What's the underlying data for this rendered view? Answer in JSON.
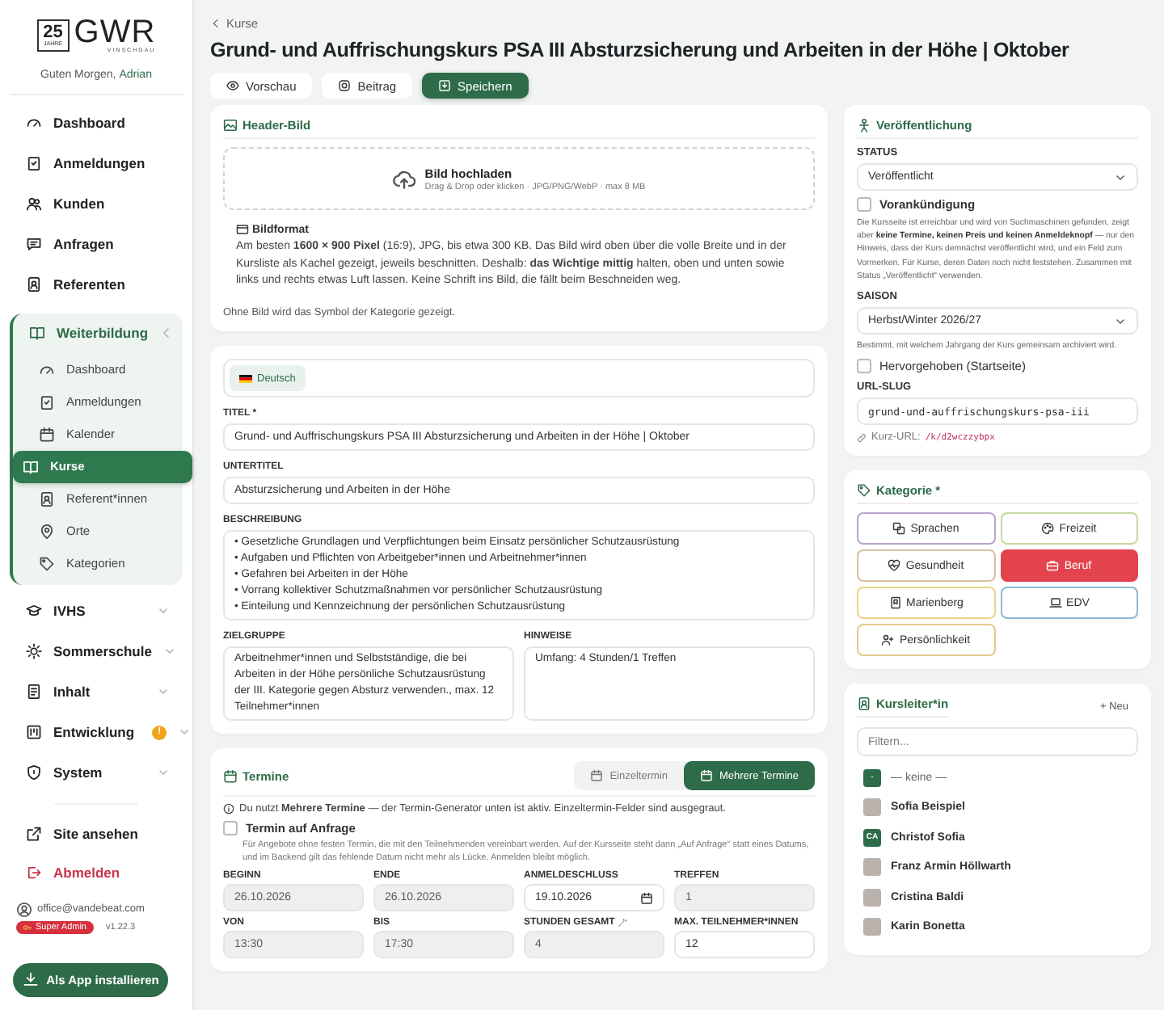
{
  "sidebar": {
    "logo": {
      "number": "25",
      "small_text": "JAHRE",
      "wordmark": "GWR",
      "subtitle": "VINSCHGAU"
    },
    "greeting": "Guten Morgen,",
    "user_name": "Adrian",
    "nav": [
      {
        "kind": "link",
        "label": "Dashboard",
        "selected": false
      },
      {
        "kind": "link",
        "label": "Anmeldungen",
        "selected": false
      },
      {
        "kind": "link",
        "label": "Kunden",
        "selected": false
      },
      {
        "kind": "link",
        "label": "Anfragen",
        "selected": false
      },
      {
        "kind": "link",
        "label": "Referenten",
        "selected": false
      },
      {
        "kind": "group",
        "label": "Weiterbildung",
        "expanded": true,
        "children": [
          {
            "label": "Dashboard",
            "selected": false
          },
          {
            "label": "Anmeldungen",
            "selected": false
          },
          {
            "label": "Kalender",
            "selected": false
          },
          {
            "label": "Kurse",
            "selected": true
          },
          {
            "label": "Referent*innen",
            "selected": false
          },
          {
            "label": "Orte",
            "selected": false
          },
          {
            "label": "Kategorien",
            "selected": false
          }
        ]
      },
      {
        "kind": "group",
        "label": "IVHS",
        "expanded": false
      },
      {
        "kind": "group",
        "label": "Sommerschule",
        "expanded": false
      },
      {
        "kind": "group",
        "label": "Inhalt",
        "expanded": false
      },
      {
        "kind": "group",
        "label": "Entwicklung",
        "expanded": false,
        "badge": "!"
      },
      {
        "kind": "group",
        "label": "System",
        "expanded": false
      }
    ],
    "footer_links": [
      {
        "kind": "external",
        "label": "Site ansehen"
      },
      {
        "kind": "logout",
        "label": "Abmelden"
      }
    ],
    "account": {
      "email": "office@vandebeat.com",
      "role": "Super Admin",
      "version": "v1.22.3"
    },
    "install_button": "Als App installieren"
  },
  "breadcrumb": "Kurse",
  "title": "Grund- und Auffrischungskurs PSA III Absturzsicherung und Arbeiten in der Höhe | Oktober",
  "actions": [
    {
      "kind": "secondary",
      "label": "Vorschau"
    },
    {
      "kind": "secondary",
      "label": "Beitrag"
    },
    {
      "kind": "primary",
      "label": "Speichern"
    }
  ],
  "header_image": {
    "title": "Header-Bild",
    "upload_title": "Bild hochladen",
    "upload_hint": "Drag & Drop oder klicken · JPG/PNG/WebP · max 8 MB",
    "format_title": "Bildformat",
    "format_text": "Am besten **1600 × 900 Pixel** (16:9), JPG, bis etwa 300 KB. Das Bild wird oben über die volle Breite und in der Kursliste als Kachel gezeigt, jeweils beschnitten. Deshalb: **das Wichtige mittig** halten, oben und unten sowie links und rechts etwas Luft lassen. Keine Schrift ins Bild, die fällt beim Beschneiden weg.",
    "note": "Ohne Bild wird das Symbol der Kategorie gezeigt."
  },
  "content": {
    "language_tabs": [
      {
        "label": "Deutsch",
        "selected": true
      }
    ],
    "title_label": "TITEL *",
    "title_value": "Grund- und Auffrischungskurs PSA III Absturzsicherung und Arbeiten in der Höhe | Oktober",
    "subtitle_label": "UNTERTITEL",
    "subtitle_value": "Absturzsicherung und Arbeiten in der Höhe",
    "description_label": "BESCHREIBUNG",
    "description_lines": [
      "• Gesetzliche Grundlagen und Verpflichtungen beim Einsatz persönlicher Schutzausrüstung",
      "• Aufgaben und Pflichten von Arbeitgeber*innen und Arbeitnehmer*innen",
      "• Gefahren bei Arbeiten in der Höhe",
      "• Vorrang kollektiver Schutzmaßnahmen vor persönlicher Schutzausrüstung",
      "• Einteilung und Kennzeichnung der persönlichen Schutzausrüstung"
    ],
    "target_label": "ZIELGRUPPE",
    "target_value": "Arbeitnehmer*innen und Selbstständige, die bei Arbeiten in der Höhe persönliche Schutzausrüstung der III. Kategorie gegen Absturz verwenden., max. 12 Teilnehmer*innen",
    "notes_label": "HINWEISE",
    "notes_value": "Umfang: 4 Stunden/1 Treffen"
  },
  "dates": {
    "title": "Termine",
    "modes": [
      {
        "label": "Einzeltermin",
        "selected": false
      },
      {
        "label": "Mehrere Termine",
        "selected": true
      }
    ],
    "info": "Du nutzt **Mehrere Termine** — der Termin-Generator unten ist aktiv. Einzeltermin-Felder sind ausgegraut.",
    "on_request": {
      "label": "Termin auf Anfrage",
      "checked": false,
      "hint": "Für Angebote ohne festen Termin, die mit den Teilnehmenden vereinbart werden. Auf der Kursseite steht dann „Auf Anfrage“ statt eines Datums, und im Backend gilt das fehlende Datum nicht mehr als Lücke. Anmelden bleibt möglich."
    },
    "fields": [
      {
        "kind": "text",
        "label": "BEGINN",
        "value": "26.10.2026",
        "disabled": true
      },
      {
        "kind": "text",
        "label": "ENDE",
        "value": "26.10.2026",
        "disabled": true
      },
      {
        "kind": "date",
        "label": "ANMELDESCHLUSS",
        "value": "19.10.2026",
        "disabled": false
      },
      {
        "kind": "text",
        "label": "TREFFEN",
        "value": "1",
        "disabled": true
      },
      {
        "kind": "text",
        "label": "VON",
        "value": "13:30",
        "disabled": true
      },
      {
        "kind": "text",
        "label": "BIS",
        "value": "17:30",
        "disabled": true
      },
      {
        "kind": "computed",
        "label": "STUNDEN GESAMT",
        "value": "4",
        "disabled": true
      },
      {
        "kind": "text",
        "label": "MAX. TEILNEHMER*INNEN",
        "value": "12",
        "disabled": false
      }
    ]
  },
  "publication": {
    "title": "Veröffentlichung",
    "status_label": "STATUS",
    "status_value": "Veröffentlicht",
    "announcement": {
      "label": "Vorankündigung",
      "checked": false,
      "hint": "Die Kursseite ist erreichbar und wird von Suchmaschinen gefunden, zeigt aber **keine Termine, keinen Preis und keinen Anmeldeknopf** — nur den Hinweis, dass der Kurs demnächst veröffentlicht wird, und ein Feld zum Vormerken. Für Kurse, deren Daten noch nicht feststehen. Zusammen mit Status „Veröffentlicht“ verwenden."
    },
    "season_label": "SAISON",
    "season_value": "Herbst/Winter 2026/27",
    "season_hint": "Bestimmt, mit welchem Jahrgang der Kurs gemeinsam archiviert wird.",
    "featured": {
      "label": "Hervorgehoben (Startseite)",
      "checked": false
    },
    "slug_label": "URL-SLUG",
    "slug_value": "grund-und-auffrischungskurs-psa-iii",
    "short_url_label": "Kurz-URL:",
    "short_url": "/k/d2wczzybpx"
  },
  "category": {
    "title": "Kategorie *",
    "options": [
      {
        "label": "Sprachen",
        "color": "#b9a3cf",
        "selected": false
      },
      {
        "label": "Freizeit",
        "color": "#c5d9a0",
        "selected": false
      },
      {
        "label": "Gesundheit",
        "color": "#d7bfa0",
        "selected": false
      },
      {
        "label": "Beruf",
        "color": "#e2434d",
        "selected": true
      },
      {
        "label": "Marienberg",
        "color": "#ead488",
        "selected": false
      },
      {
        "label": "EDV",
        "color": "#8bb8d6",
        "selected": false
      },
      {
        "label": "Persönlichkeit",
        "color": "#e3c98e",
        "selected": false
      }
    ]
  },
  "instructors": {
    "title": "Kursleiter*in",
    "new_button": "+ Neu",
    "filter_placeholder": "Filtern...",
    "items": [
      {
        "kind": "initials",
        "avatar_text": "-",
        "name": "— keine —"
      },
      {
        "kind": "photo",
        "name": "Sofia Beispiel"
      },
      {
        "kind": "initials",
        "avatar_text": "CA",
        "name": "Christof Sofia"
      },
      {
        "kind": "photo",
        "name": "Franz Armin Höllwarth"
      },
      {
        "kind": "photo",
        "name": "Cristina Baldi"
      },
      {
        "kind": "photo",
        "name": "Karin Bonetta"
      }
    ]
  }
}
